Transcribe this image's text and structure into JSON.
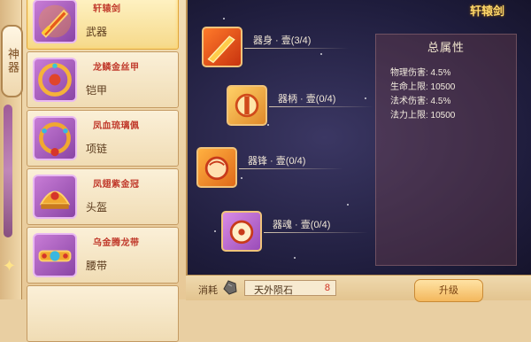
{
  "side_tab": {
    "label": "神器"
  },
  "items": [
    {
      "name": "轩辕剑",
      "category": "武器",
      "selected": true,
      "icon": "sword-icon"
    },
    {
      "name": "龙鳞金丝甲",
      "category": "铠甲",
      "selected": false,
      "icon": "armor-icon"
    },
    {
      "name": "凤血琉璃佩",
      "category": "项链",
      "selected": false,
      "icon": "necklace-icon"
    },
    {
      "name": "凤翅紫金冠",
      "category": "头盔",
      "selected": false,
      "icon": "helmet-icon"
    },
    {
      "name": "乌金腾龙带",
      "category": "腰带",
      "selected": false,
      "icon": "belt-icon"
    }
  ],
  "artifact": {
    "title": "轩辕剑"
  },
  "parts": [
    {
      "label": "器身 · 壹(3/4)",
      "icon": "blade-icon"
    },
    {
      "label": "器柄 · 壹(0/4)",
      "icon": "hilt-icon"
    },
    {
      "label": "器锋 · 壹(0/4)",
      "icon": "edge-icon"
    },
    {
      "label": "器魂 · 壹(0/4)",
      "icon": "soul-icon"
    }
  ],
  "stats": {
    "header": "总属性",
    "lines": [
      "物理伤害: 4.5%",
      "生命上限: 10500",
      "法术伤害: 4.5%",
      "法力上限: 10500"
    ]
  },
  "cost": {
    "label": "消耗",
    "material": "天外陨石",
    "amount": "8"
  },
  "upgrade_button": "升级",
  "colors": {
    "accent": "#ffd86a",
    "cost_red": "#d03020"
  }
}
